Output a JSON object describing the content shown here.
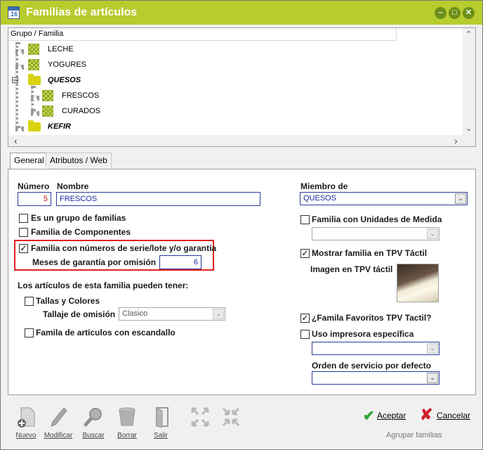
{
  "window": {
    "title": "Familias de artículos",
    "icon_text": "16",
    "controls": [
      "–",
      "□",
      "✕"
    ]
  },
  "tree": {
    "header": "Grupo / Familia",
    "scroll_up": "⌃",
    "scroll_down": "⌄",
    "scroll_left": "‹",
    "scroll_right": "›",
    "nodes": [
      {
        "label": "LECHE",
        "type": "leaf"
      },
      {
        "label": "YOGURES",
        "type": "leaf"
      },
      {
        "label": "QUESOS",
        "type": "folder-open",
        "expand": "⊟"
      },
      {
        "label": "FRESCOS",
        "type": "leaf"
      },
      {
        "label": "CURADOS",
        "type": "leaf"
      },
      {
        "label": "KEFIR",
        "type": "folder"
      }
    ]
  },
  "tabs": [
    {
      "label": "General",
      "active": true
    },
    {
      "label": "Atributos / Web",
      "active": false
    }
  ],
  "form": {
    "numero_label": "Número",
    "numero_value": "5",
    "nombre_label": "Nombre",
    "nombre_value": "FRESCOS",
    "grupo_label": "Es un grupo de familias",
    "grupo_checked": false,
    "componentes_label": "Familia de Componentes",
    "componentes_checked": false,
    "serie_label": "Familia con números de serie/lote y/o garantía",
    "serie_checked": true,
    "garantia_label": "Meses de garantía por omisión",
    "garantia_value": "6",
    "articulos_label": "Los artículos de esta familia pueden tener:",
    "tallas_label": "Tallas y Colores",
    "tallas_checked": false,
    "tallaje_label": "Tallaje de omisión",
    "tallaje_value": "Clasico",
    "escandallo_label": "Famila de artículos con escandallo",
    "escandallo_checked": false,
    "miembro_label": "Miembro de",
    "miembro_value": "QUESOS",
    "unidades_label": "Familia con Unidades de Medida",
    "unidades_checked": false,
    "unidades_value": "",
    "tpv_label": "Mostrar familia en TPV Táctil",
    "tpv_checked": true,
    "imagen_label": "Imagen en TPV táctil",
    "favoritos_label": "¿Famila Favoritos TPV Tactil?",
    "favoritos_checked": true,
    "impresora_label": "Uso impresora específica",
    "impresora_checked": false,
    "impresora_value": "",
    "orden_label": "Orden de servicio por defecto",
    "orden_value": "",
    "check_glyph": "✓",
    "dropdown_glyph": "⌄"
  },
  "toolbar": {
    "nuevo": "Nuevo",
    "modificar": "Modificar",
    "buscar": "Buscar",
    "borrar": "Borrar",
    "salir": "Salir",
    "aceptar": "Aceptar",
    "cancelar": "Cancelar",
    "agrupar": "Agrupar familias",
    "ok_glyph": "✔",
    "cancel_glyph": "✘"
  },
  "colors": {
    "titlebar": "#b7cc2d",
    "highlight_border": "#e02020"
  }
}
